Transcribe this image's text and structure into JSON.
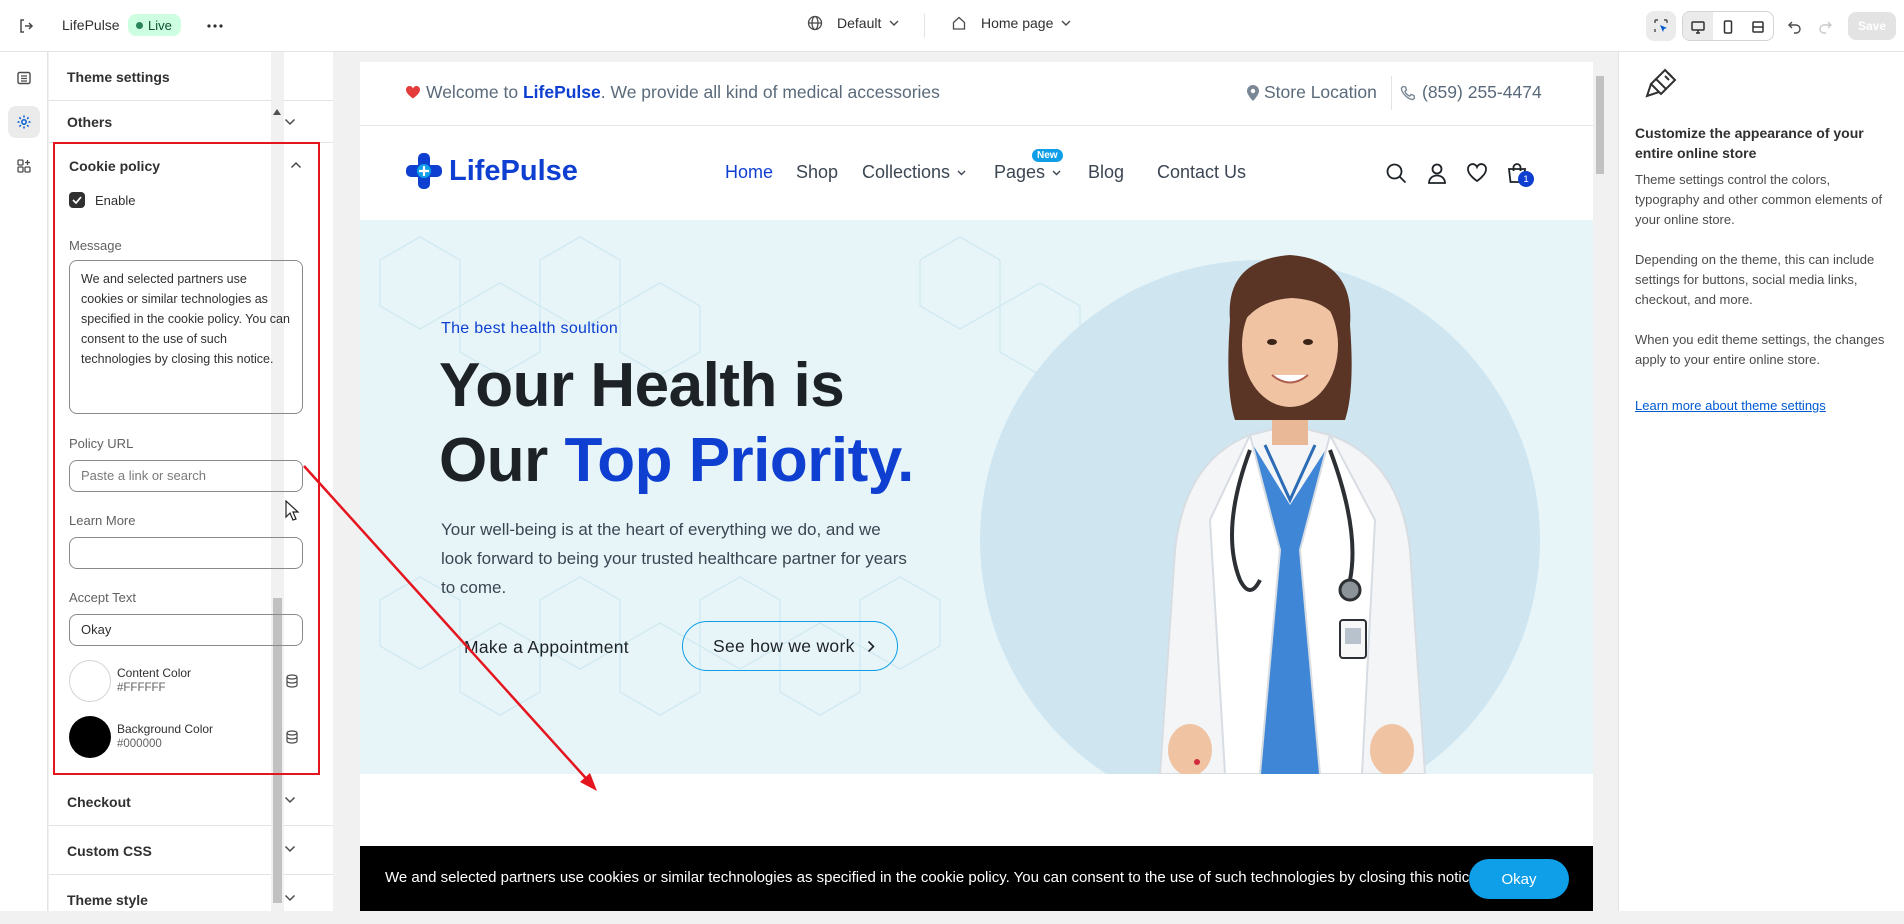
{
  "topbar": {
    "store_name": "LifePulse",
    "status_badge": "Live",
    "theme_selector": "Default",
    "page_selector": "Home page",
    "save_label": "Save"
  },
  "settings_panel": {
    "title": "Theme settings",
    "sections": {
      "others": "Others",
      "checkout": "Checkout",
      "custom_css": "Custom CSS",
      "theme_style": "Theme style"
    },
    "cookie_policy": {
      "title": "Cookie policy",
      "enable_label": "Enable",
      "enabled": true,
      "message_label": "Message",
      "message_value": "We and selected partners use cookies or similar technologies as specified in the cookie policy. You can consent to the use of such technologies by closing this notice.",
      "policy_url_label": "Policy URL",
      "policy_url_placeholder": "Paste a link or search",
      "learn_more_label": "Learn More",
      "learn_more_value": "",
      "accept_text_label": "Accept Text",
      "accept_text_value": "Okay",
      "content_color_label": "Content Color",
      "content_color_value": "#FFFFFF",
      "background_color_label": "Background Color",
      "background_color_value": "#000000"
    }
  },
  "preview": {
    "welcome_prefix": "Welcome to",
    "welcome_brand": "LifePulse",
    "welcome_suffix": ". We provide all kind of medical accessories",
    "store_location": "Store Location",
    "phone": "(859) 255-4474",
    "logo_text": "LifePulse",
    "nav": {
      "home": "Home",
      "shop": "Shop",
      "collections": "Collections",
      "pages": "Pages",
      "pages_badge": "New",
      "blog": "Blog",
      "contact": "Contact Us"
    },
    "cart_count": "1",
    "hero": {
      "tagline": "The best health soultion",
      "heading_line1": "Your Health is",
      "heading_line2_plain": "Our ",
      "heading_line2_accent": "Top Priority.",
      "body": "Your well-being is at the heart of everything we do, and we look forward to being your trusted healthcare partner for years to come.",
      "button_primary": "Make a Appointment",
      "button_secondary": "See how we work"
    },
    "cookie_bar": {
      "text": "We and selected partners use cookies or similar technologies as specified in the cookie policy. You can consent to the use of such technologies by closing this notice.",
      "button": "Okay"
    }
  },
  "help_panel": {
    "heading": "Customize the appearance of your entire online store",
    "para1": "Theme settings control the colors, typography and other common elements of your online store.",
    "para2": "Depending on the theme, this can include settings for buttons, social media links, checkout, and more.",
    "para3": "When you edit theme settings, the changes apply to your entire online store.",
    "link": "Learn more about theme settings"
  },
  "colors": {
    "brand_blue": "#0e3fd0",
    "accent_cyan": "#0e9fe8",
    "annotation_red": "#e4151e",
    "live_badge": "#cdfee1"
  }
}
